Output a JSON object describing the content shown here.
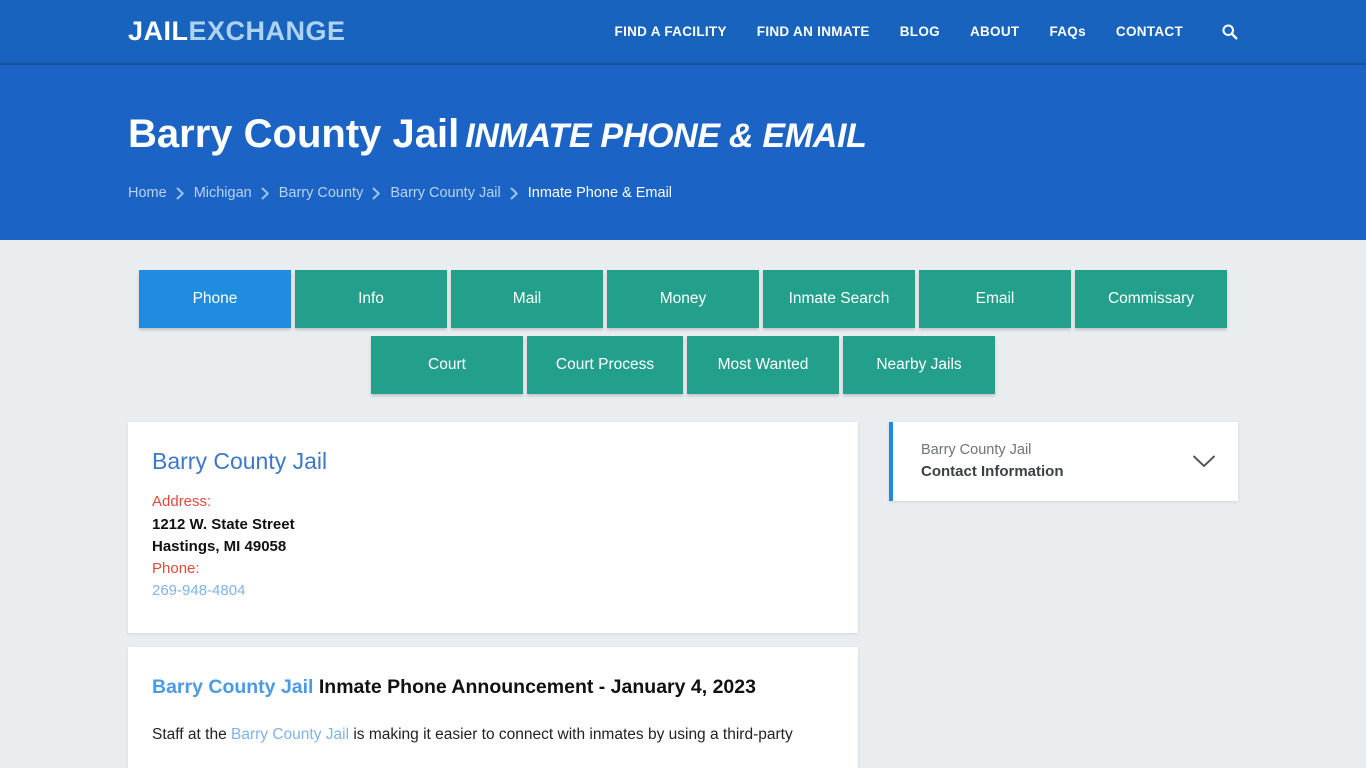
{
  "nav": {
    "logo_primary": "JAIL",
    "logo_secondary": "EXCHANGE",
    "links": [
      {
        "label": "FIND A FACILITY"
      },
      {
        "label": "FIND AN INMATE"
      },
      {
        "label": "BLOG"
      },
      {
        "label": "ABOUT"
      },
      {
        "label": "FAQs"
      },
      {
        "label": "CONTACT"
      }
    ],
    "search_icon": "search-icon"
  },
  "hero": {
    "title_main": "Barry County Jail",
    "title_sub": "INMATE PHONE & EMAIL",
    "breadcrumb": [
      {
        "label": "Home",
        "active": false
      },
      {
        "label": "Michigan",
        "active": false
      },
      {
        "label": "Barry County",
        "active": false
      },
      {
        "label": "Barry County Jail",
        "active": false
      },
      {
        "label": "Inmate Phone & Email",
        "active": true
      }
    ],
    "separator_icon": "chevron-right-icon"
  },
  "tabs": {
    "row1": [
      {
        "label": "Phone",
        "active": true
      },
      {
        "label": "Info",
        "active": false
      },
      {
        "label": "Mail",
        "active": false
      },
      {
        "label": "Money",
        "active": false
      },
      {
        "label": "Inmate Search",
        "active": false
      },
      {
        "label": "Email",
        "active": false
      },
      {
        "label": "Commissary",
        "active": false
      }
    ],
    "row2": [
      {
        "label": "Court",
        "active": false
      },
      {
        "label": "Court Process",
        "active": false
      },
      {
        "label": "Most Wanted",
        "active": false
      },
      {
        "label": "Nearby Jails",
        "active": false
      }
    ]
  },
  "facility_card": {
    "name": "Barry County Jail",
    "address_label": "Address:",
    "address_line1": "1212 W. State Street",
    "address_line2": "Hastings, MI 49058",
    "phone_label": "Phone:",
    "phone_value": "269-948-4804"
  },
  "article": {
    "title_link": "Barry County Jail",
    "title_rest": " Inmate Phone Announcement - January 4, 2023",
    "body_pre": "Staff at the ",
    "body_link": "Barry County Jail",
    "body_post": " is making it easier to connect with inmates by using a third-party"
  },
  "sidebar": {
    "accordion_sub": "Barry County Jail",
    "accordion_title": "Contact Information",
    "chevron_icon": "chevron-down-icon"
  },
  "colors": {
    "nav_blue": "#1863be",
    "hero_blue": "#1b63c4",
    "tab_teal": "#22a08c",
    "tab_active_blue": "#1f8ce0",
    "page_bg": "#e9edf0",
    "label_red": "#e2483c",
    "link_blue": "#7fb3e8",
    "heading_blue": "#3c78c8"
  }
}
